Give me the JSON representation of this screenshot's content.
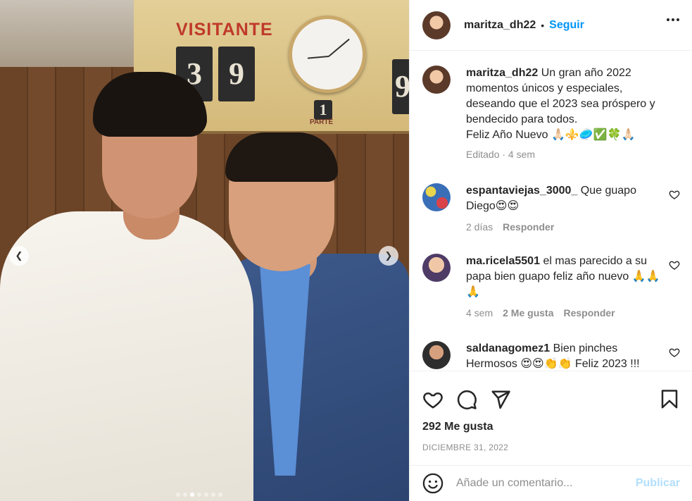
{
  "photo": {
    "sign_text": "VISITANTE",
    "tile_left": "3",
    "tile_mid": "9",
    "tile_right": "9",
    "tile_small": "1",
    "parte_text": "PARTE",
    "prev_icon": "chevron-left-icon",
    "next_icon": "chevron-right-icon",
    "carousel_count": 7,
    "carousel_active": 3
  },
  "header": {
    "username": "maritza_dh22",
    "separator": "•",
    "follow": "Seguir",
    "more_icon": "more-horizontal-icon"
  },
  "caption": {
    "username": "maritza_dh22",
    "text": "Un gran año 2022 momentos únicos y especiales, deseando que el 2023 sea próspero y bendecido para todos.\nFeliz Año Nuevo 🙏🏻⚜️🥏✅🍀🙏🏻",
    "meta": "Editado · 4 sem"
  },
  "comments": [
    {
      "username": "espantaviejas_3000_",
      "text": "Que guapo Diego😍😍",
      "time": "2 días",
      "likes": "",
      "reply": "Responder"
    },
    {
      "username": "ma.ricela5501",
      "text": "el mas parecido a su papa bien guapo feliz año nuevo 🙏🙏🙏",
      "time": "4 sem",
      "likes": "2 Me gusta",
      "reply": "Responder"
    },
    {
      "username": "saldanagomez1",
      "text": "Bien pinches Hermosos 😍😍👏👏 Feliz 2023 !!!",
      "time": "",
      "likes": "",
      "reply": ""
    }
  ],
  "actions": {
    "like_icon": "heart-icon",
    "comment_icon": "comment-icon",
    "share_icon": "send-icon",
    "save_icon": "bookmark-icon",
    "likes": "292 Me gusta",
    "date": "DICIEMBRE 31, 2022"
  },
  "add_comment": {
    "emoji_icon": "emoji-icon",
    "placeholder": "Añade un comentario...",
    "publish": "Publicar"
  },
  "colors": {
    "accent": "#0095f6",
    "publish_disabled": "#b2dffc",
    "text": "#262626",
    "muted": "#8e8e8e"
  }
}
